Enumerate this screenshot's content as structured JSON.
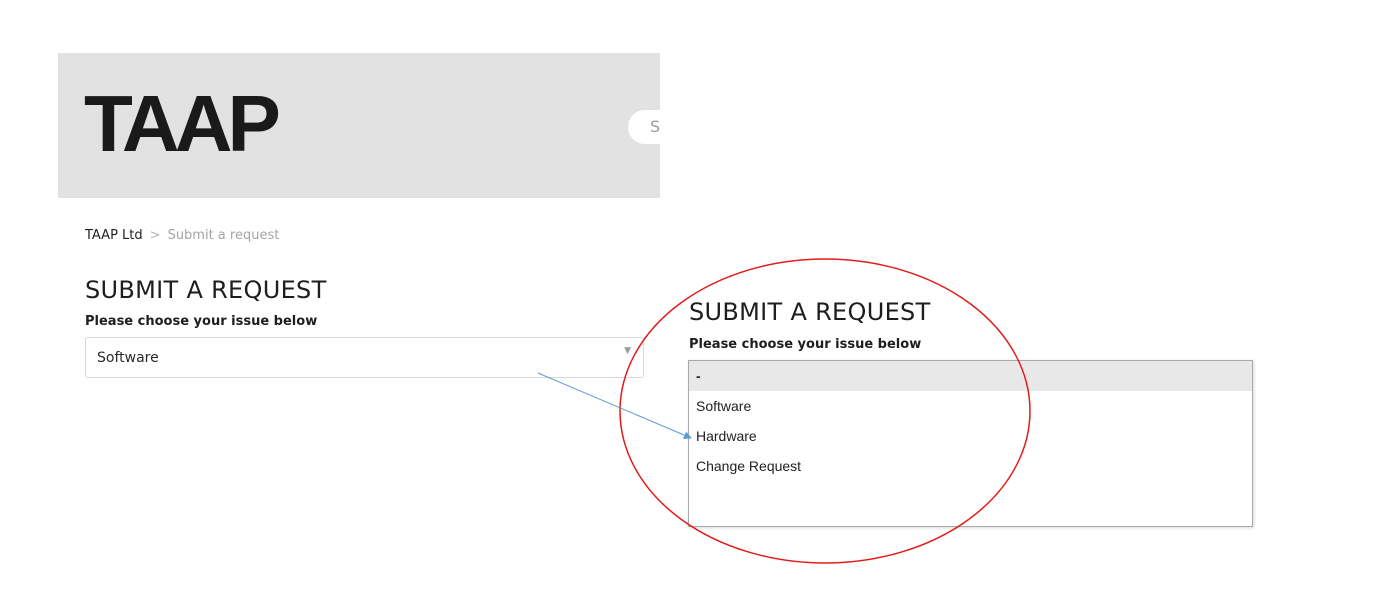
{
  "header": {
    "logo_text": "TAAP",
    "search_placeholder_fragment": "S"
  },
  "breadcrumb": {
    "home": "TAAP Ltd",
    "separator": ">",
    "current": "Submit a request"
  },
  "form_left": {
    "title": "SUBMIT A REQUEST",
    "label": "Please choose your issue below",
    "selected_value": "Software"
  },
  "form_right": {
    "title": "SUBMIT A REQUEST",
    "label": "Please choose your issue below",
    "options": [
      "-",
      "Software",
      "Hardware",
      "Change Request"
    ],
    "highlighted_index": 0
  },
  "annotation": {
    "circle_color": "#e31b1b",
    "arrow_color": "#5b9bd5",
    "arrow_target": "Hardware"
  },
  "colors": {
    "header_bg": "#e2e2e2",
    "logo": "#1a1a1a"
  }
}
